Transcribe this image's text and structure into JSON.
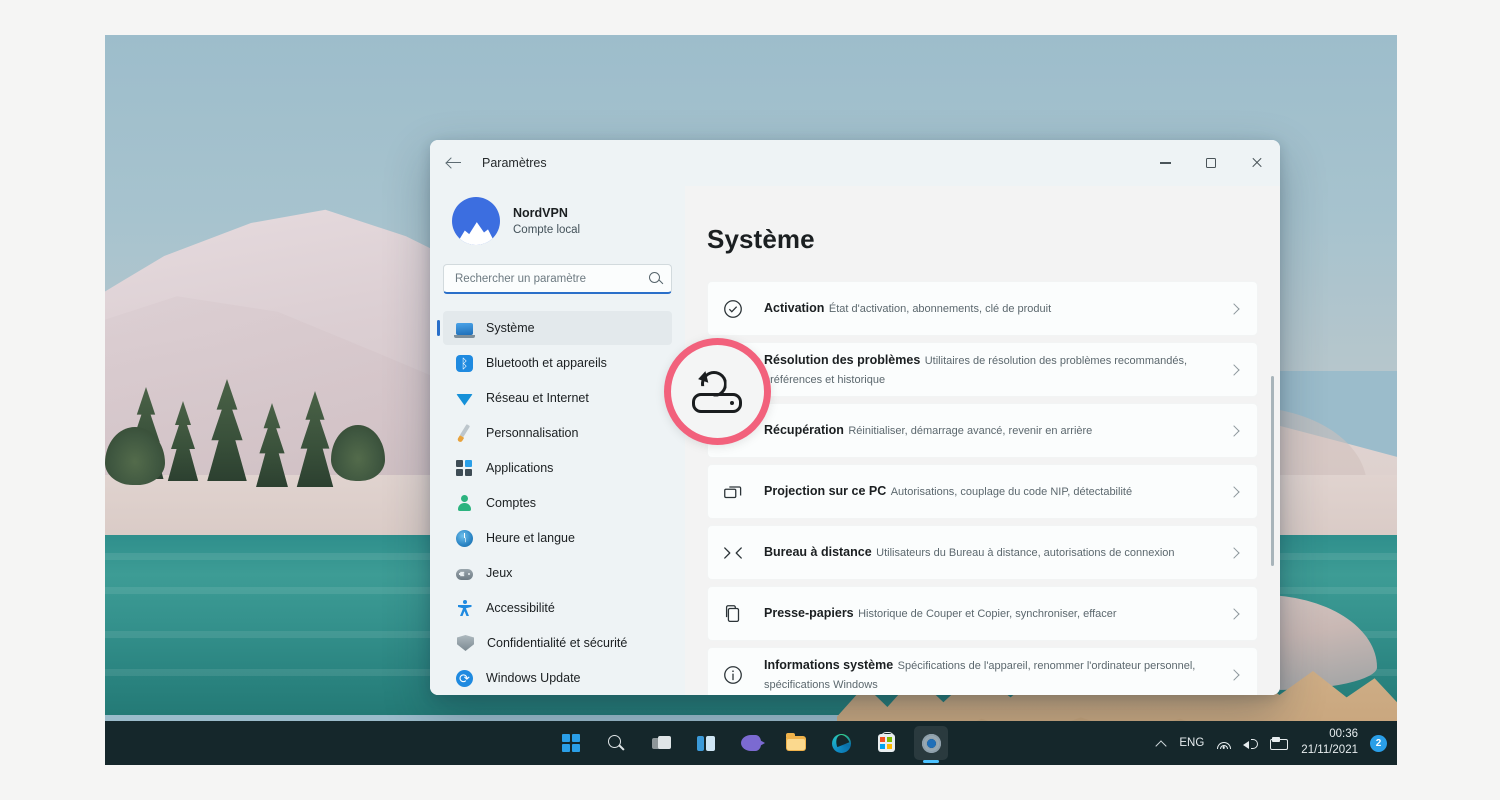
{
  "window": {
    "title": "Paramètres",
    "back_icon": "back-arrow-icon",
    "minimize_icon": "minimize-icon",
    "maximize_icon": "maximize-icon",
    "close_icon": "close-icon"
  },
  "account": {
    "name": "NordVPN",
    "type": "Compte local",
    "avatar_icon": "nordvpn-mountain-avatar"
  },
  "search": {
    "placeholder": "Rechercher un paramètre",
    "value": "",
    "icon": "search-icon"
  },
  "sidebar": {
    "items": [
      {
        "label": "Système",
        "icon": "laptop-icon",
        "selected": true
      },
      {
        "label": "Bluetooth et appareils",
        "icon": "bluetooth-icon",
        "selected": false
      },
      {
        "label": "Réseau et Internet",
        "icon": "wifi-icon",
        "selected": false
      },
      {
        "label": "Personnalisation",
        "icon": "paintbrush-icon",
        "selected": false
      },
      {
        "label": "Applications",
        "icon": "apps-grid-icon",
        "selected": false
      },
      {
        "label": "Comptes",
        "icon": "person-icon",
        "selected": false
      },
      {
        "label": "Heure et langue",
        "icon": "clock-icon",
        "selected": false
      },
      {
        "label": "Jeux",
        "icon": "gamepad-icon",
        "selected": false
      },
      {
        "label": "Accessibilité",
        "icon": "accessibility-icon",
        "selected": false
      },
      {
        "label": "Confidentialité et sécurité",
        "icon": "shield-icon",
        "selected": false
      },
      {
        "label": "Windows Update",
        "icon": "update-refresh-icon",
        "selected": false
      }
    ]
  },
  "main": {
    "page_title": "Système",
    "cards": [
      {
        "title": "Activation",
        "subtitle": "État d'activation, abonnements, clé de produit",
        "icon": "check-circle-icon"
      },
      {
        "title": "Résolution des problèmes",
        "subtitle": "Utilitaires de résolution des problèmes recommandés, préférences et historique",
        "icon": "wrench-icon"
      },
      {
        "title": "Récupération",
        "subtitle": "Réinitialiser, démarrage avancé, revenir en arrière",
        "icon": "recovery-drive-icon"
      },
      {
        "title": "Projection sur ce PC",
        "subtitle": "Autorisations, couplage du code NIP, détectabilité",
        "icon": "screens-icon"
      },
      {
        "title": "Bureau à distance",
        "subtitle": "Utilisateurs du Bureau à distance, autorisations de connexion",
        "icon": "remote-desktop-icon"
      },
      {
        "title": "Presse-papiers",
        "subtitle": "Historique de Couper et Copier, synchroniser, effacer",
        "icon": "clipboard-icon"
      },
      {
        "title": "Informations système",
        "subtitle": "Spécifications de l'appareil, renommer l'ordinateur personnel, spécifications Windows",
        "icon": "info-circle-icon"
      }
    ],
    "chevron_icon": "chevron-right-icon"
  },
  "magnifier": {
    "icon": "recovery-drive-icon",
    "ring_color": "#f2617c"
  },
  "taskbar": {
    "items": [
      {
        "name": "start-button",
        "icon": "windows-start-icon",
        "active": false
      },
      {
        "name": "search-button",
        "icon": "search-icon",
        "active": false
      },
      {
        "name": "task-view-button",
        "icon": "task-view-icon",
        "active": false
      },
      {
        "name": "widgets-button",
        "icon": "widgets-icon",
        "active": false
      },
      {
        "name": "teams-button",
        "icon": "teams-chat-icon",
        "active": false
      },
      {
        "name": "file-explorer-button",
        "icon": "folder-icon",
        "active": false
      },
      {
        "name": "edge-button",
        "icon": "edge-browser-icon",
        "active": false
      },
      {
        "name": "store-button",
        "icon": "microsoft-store-icon",
        "active": false
      },
      {
        "name": "settings-button",
        "icon": "gear-icon",
        "active": true
      }
    ],
    "tray": {
      "chevron_icon": "chevron-up-icon",
      "language": "ENG",
      "wifi_icon": "wifi-icon",
      "volume_icon": "speaker-icon",
      "battery_icon": "battery-icon",
      "time": "00:36",
      "date": "21/11/2021",
      "notification_count": "2"
    }
  },
  "colors": {
    "accent": "#2a6fc9",
    "taskbar_bg": "#15272b",
    "window_bg": "#f3f3f3",
    "sidebar_bg": "#eef3f5",
    "card_bg": "#fbfdfd",
    "magnifier_ring": "#f2617c",
    "page_bg": "#f5f5f4"
  }
}
